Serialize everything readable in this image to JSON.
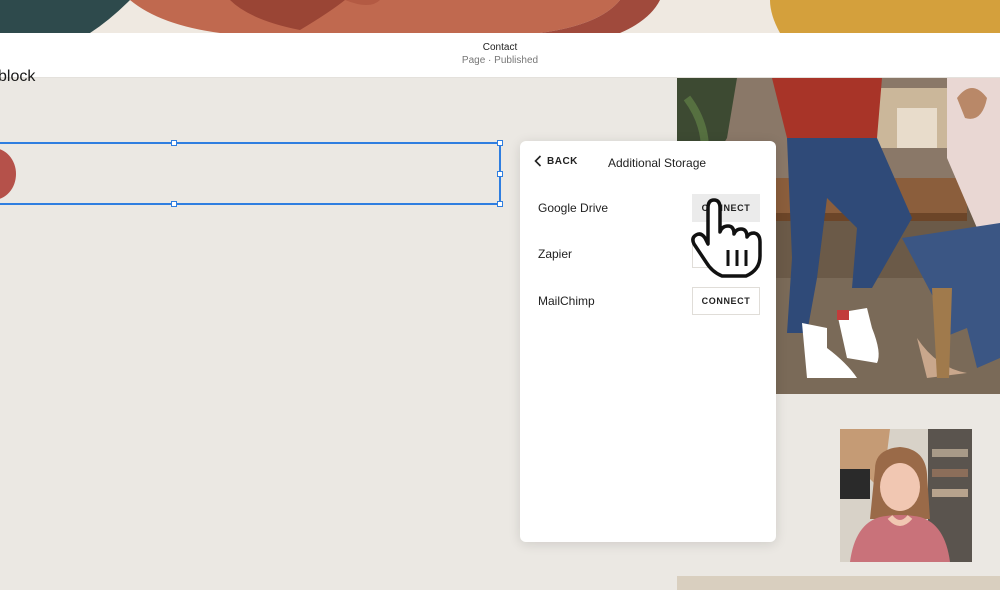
{
  "header": {
    "title": "Contact",
    "subtitle": "Page · Published"
  },
  "canvas": {
    "block_text": "block"
  },
  "panel": {
    "back_label": "BACK",
    "title": "Additional Storage",
    "integrations": [
      {
        "name": "Google Drive",
        "button": "CONNECT"
      },
      {
        "name": "Zapier",
        "button": "CONNECT"
      },
      {
        "name": "MailChimp",
        "button": "CONNECT"
      }
    ]
  },
  "colors": {
    "selection": "#2f7ee0",
    "canvas_bg": "#ebe8e3",
    "accent_red": "#b5514a",
    "button_hover_bg": "#ebebeb"
  },
  "icons": {
    "back": "chevron-left-icon",
    "cursor": "hand-pointer-icon"
  }
}
